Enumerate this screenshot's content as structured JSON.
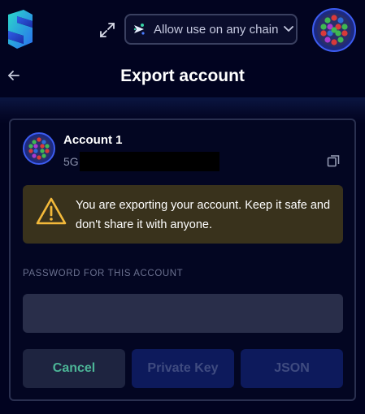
{
  "topbar": {
    "chain_selector": {
      "label": "Allow use on any chain"
    }
  },
  "header": {
    "title": "Export account"
  },
  "account": {
    "name": "Account 1",
    "address_prefix": "5G"
  },
  "warning": {
    "text": "You are exporting your account. Keep it safe and don't share it with anyone."
  },
  "password": {
    "label": "PASSWORD FOR THIS ACCOUNT",
    "value": "",
    "placeholder": ""
  },
  "buttons": {
    "cancel": "Cancel",
    "private_key": "Private Key",
    "json": "JSON"
  },
  "colors": {
    "background": "#010320",
    "card_border": "#2a3050",
    "warning_bg": "#39321c",
    "warning_accent": "#f3b93a",
    "input_bg": "#292e4a",
    "cancel_text": "#4cb597",
    "disabled_button_bg": "#0d1a5c",
    "disabled_button_text": "#3f4b80"
  },
  "icons": {
    "logo": "subwallet-logo",
    "expand": "expand-icon",
    "chain": "network-icon",
    "chevron": "chevron-down-icon",
    "back": "arrow-left-icon",
    "copy": "copy-icon",
    "warning": "warning-triangle-icon"
  }
}
